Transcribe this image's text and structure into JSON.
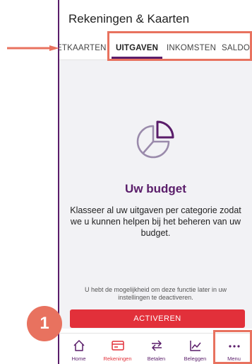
{
  "header": {
    "title": "Rekeningen & Kaarten"
  },
  "tabs": [
    {
      "label": "ETKAARTEN"
    },
    {
      "label": "UITGAVEN"
    },
    {
      "label": "INKOMSTEN"
    },
    {
      "label": "SALDO"
    }
  ],
  "active_tab": "UITGAVEN",
  "main": {
    "icon": "pie-chart-icon",
    "heading": "Uw budget",
    "body": "Klasseer al uw uitgaven per categorie zodat we u kunnen helpen bij het beheren van uw budget.",
    "note": "U hebt de mogelijkheid om deze functie later in uw instellingen te deactiveren.",
    "button_label": "ACTIVEREN"
  },
  "bottom_nav": [
    {
      "label": "Home",
      "icon": "home-icon"
    },
    {
      "label": "Rekeningen",
      "icon": "card-icon"
    },
    {
      "label": "Betalen",
      "icon": "transfer-icon"
    },
    {
      "label": "Beleggen",
      "icon": "chart-icon"
    },
    {
      "label": "Menu",
      "icon": "more-icon"
    }
  ],
  "active_nav": "Rekeningen",
  "annotations": {
    "step_number": "1"
  },
  "colors": {
    "brand_purple": "#5a1d6a",
    "accent_red": "#e2303a",
    "annotation": "#e8725f"
  }
}
